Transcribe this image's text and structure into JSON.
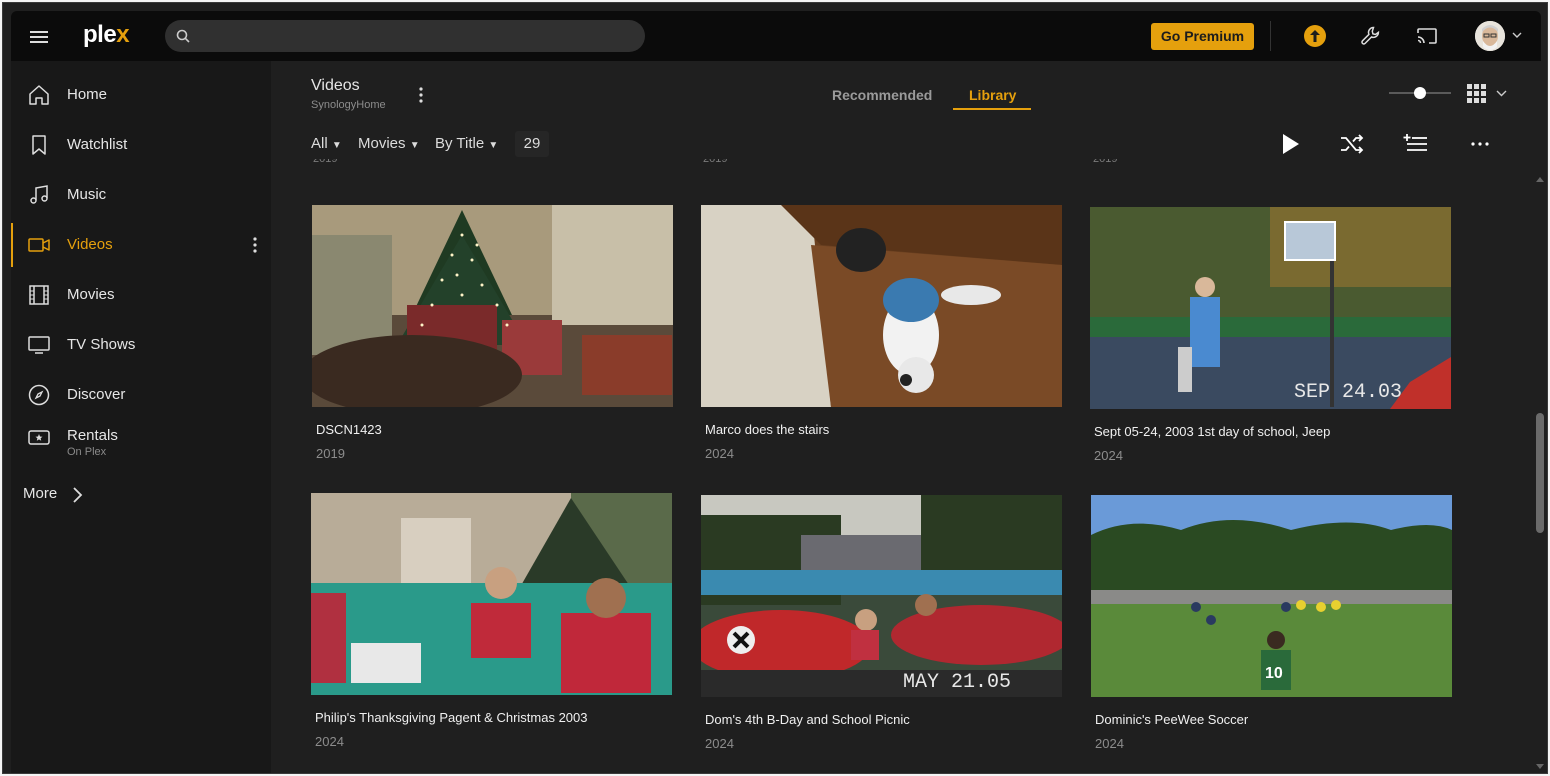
{
  "app": {
    "logo_text": "ple",
    "logo_x": "x",
    "search_placeholder": "",
    "premium_label": "Go Premium",
    "accent_color": "#e5a00d"
  },
  "sidebar": {
    "items": [
      {
        "label": "Home",
        "icon": "home-icon"
      },
      {
        "label": "Watchlist",
        "icon": "bookmark-icon"
      },
      {
        "label": "Music",
        "icon": "music-note-icon"
      },
      {
        "label": "Videos",
        "icon": "video-camera-icon",
        "active": true
      },
      {
        "label": "Movies",
        "icon": "film-strip-icon"
      },
      {
        "label": "TV Shows",
        "icon": "monitor-icon"
      },
      {
        "label": "Discover",
        "icon": "compass-icon"
      },
      {
        "label": "Rentals",
        "sub": "On Plex",
        "icon": "ticket-star-icon"
      }
    ],
    "more_label": "More"
  },
  "library": {
    "title": "Videos",
    "server": "SynologyHome"
  },
  "tabs": {
    "recommended": "Recommended",
    "library": "Library"
  },
  "filters": {
    "all": "All",
    "type": "Movies",
    "sort": "By Title",
    "count": "29"
  },
  "items": [
    {
      "title": "DSCN1423",
      "year": "2019"
    },
    {
      "title": "Marco does the stairs",
      "year": "2024"
    },
    {
      "title": "Sept 05-24, 2003 1st day of school, Jeep",
      "year": "2024",
      "stamp": "SEP 24.03"
    },
    {
      "title": "Philip's Thanksgiving Pagent & Christmas 2003",
      "year": "2024"
    },
    {
      "title": "Dom's 4th B-Day and School Picnic",
      "year": "2024",
      "stamp": "MAY 21.05"
    },
    {
      "title": "Dominic's PeeWee Soccer",
      "year": "2024"
    }
  ]
}
